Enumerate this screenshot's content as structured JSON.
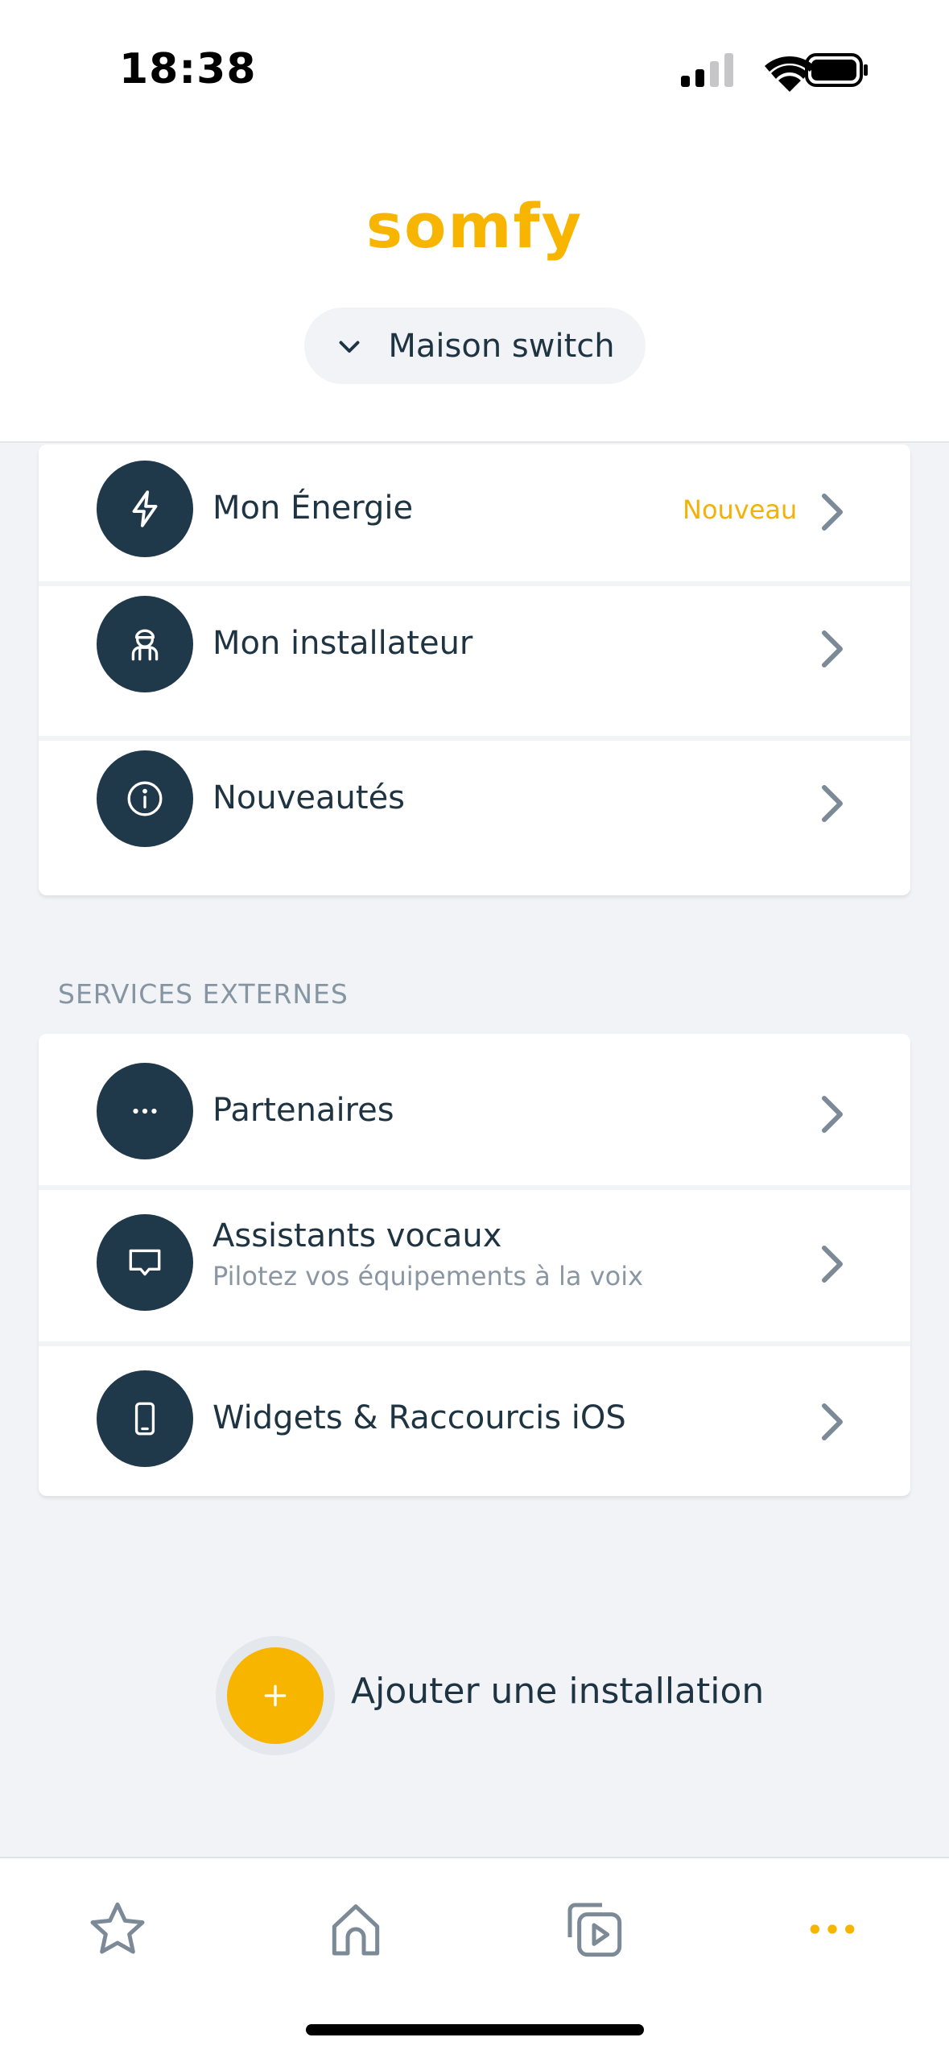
{
  "status": {
    "time": "18:38"
  },
  "brand": {
    "logo_text": "somfy",
    "accent": "#f7b500",
    "dark": "#20394a"
  },
  "house_selector": {
    "label": "Maison switch",
    "icon": "chevron-down-icon"
  },
  "menu": [
    {
      "title": "Mon Énergie",
      "badge": "Nouveau",
      "icon": "lightning-icon"
    },
    {
      "title": "Mon installateur",
      "icon": "installer-icon"
    },
    {
      "title": "Nouveautés",
      "icon": "info-icon"
    }
  ],
  "external": {
    "section_title": "SERVICES EXTERNES",
    "items": [
      {
        "title": "Partenaires",
        "icon": "more-dots-icon"
      },
      {
        "title": "Assistants vocaux",
        "subtitle": "Pilotez vos équipements à la voix",
        "icon": "speech-bubble-icon"
      },
      {
        "title": "Widgets & Raccourcis iOS",
        "icon": "phone-icon"
      }
    ]
  },
  "add_installation": {
    "label": "Ajouter une installation",
    "icon": "plus-icon"
  },
  "tabbar": [
    {
      "name": "favorites",
      "icon": "star-icon",
      "active": false
    },
    {
      "name": "home",
      "icon": "home-icon",
      "active": false
    },
    {
      "name": "scenarios",
      "icon": "play-stack-icon",
      "active": false
    },
    {
      "name": "more",
      "icon": "more-dots-icon",
      "active": true
    }
  ]
}
